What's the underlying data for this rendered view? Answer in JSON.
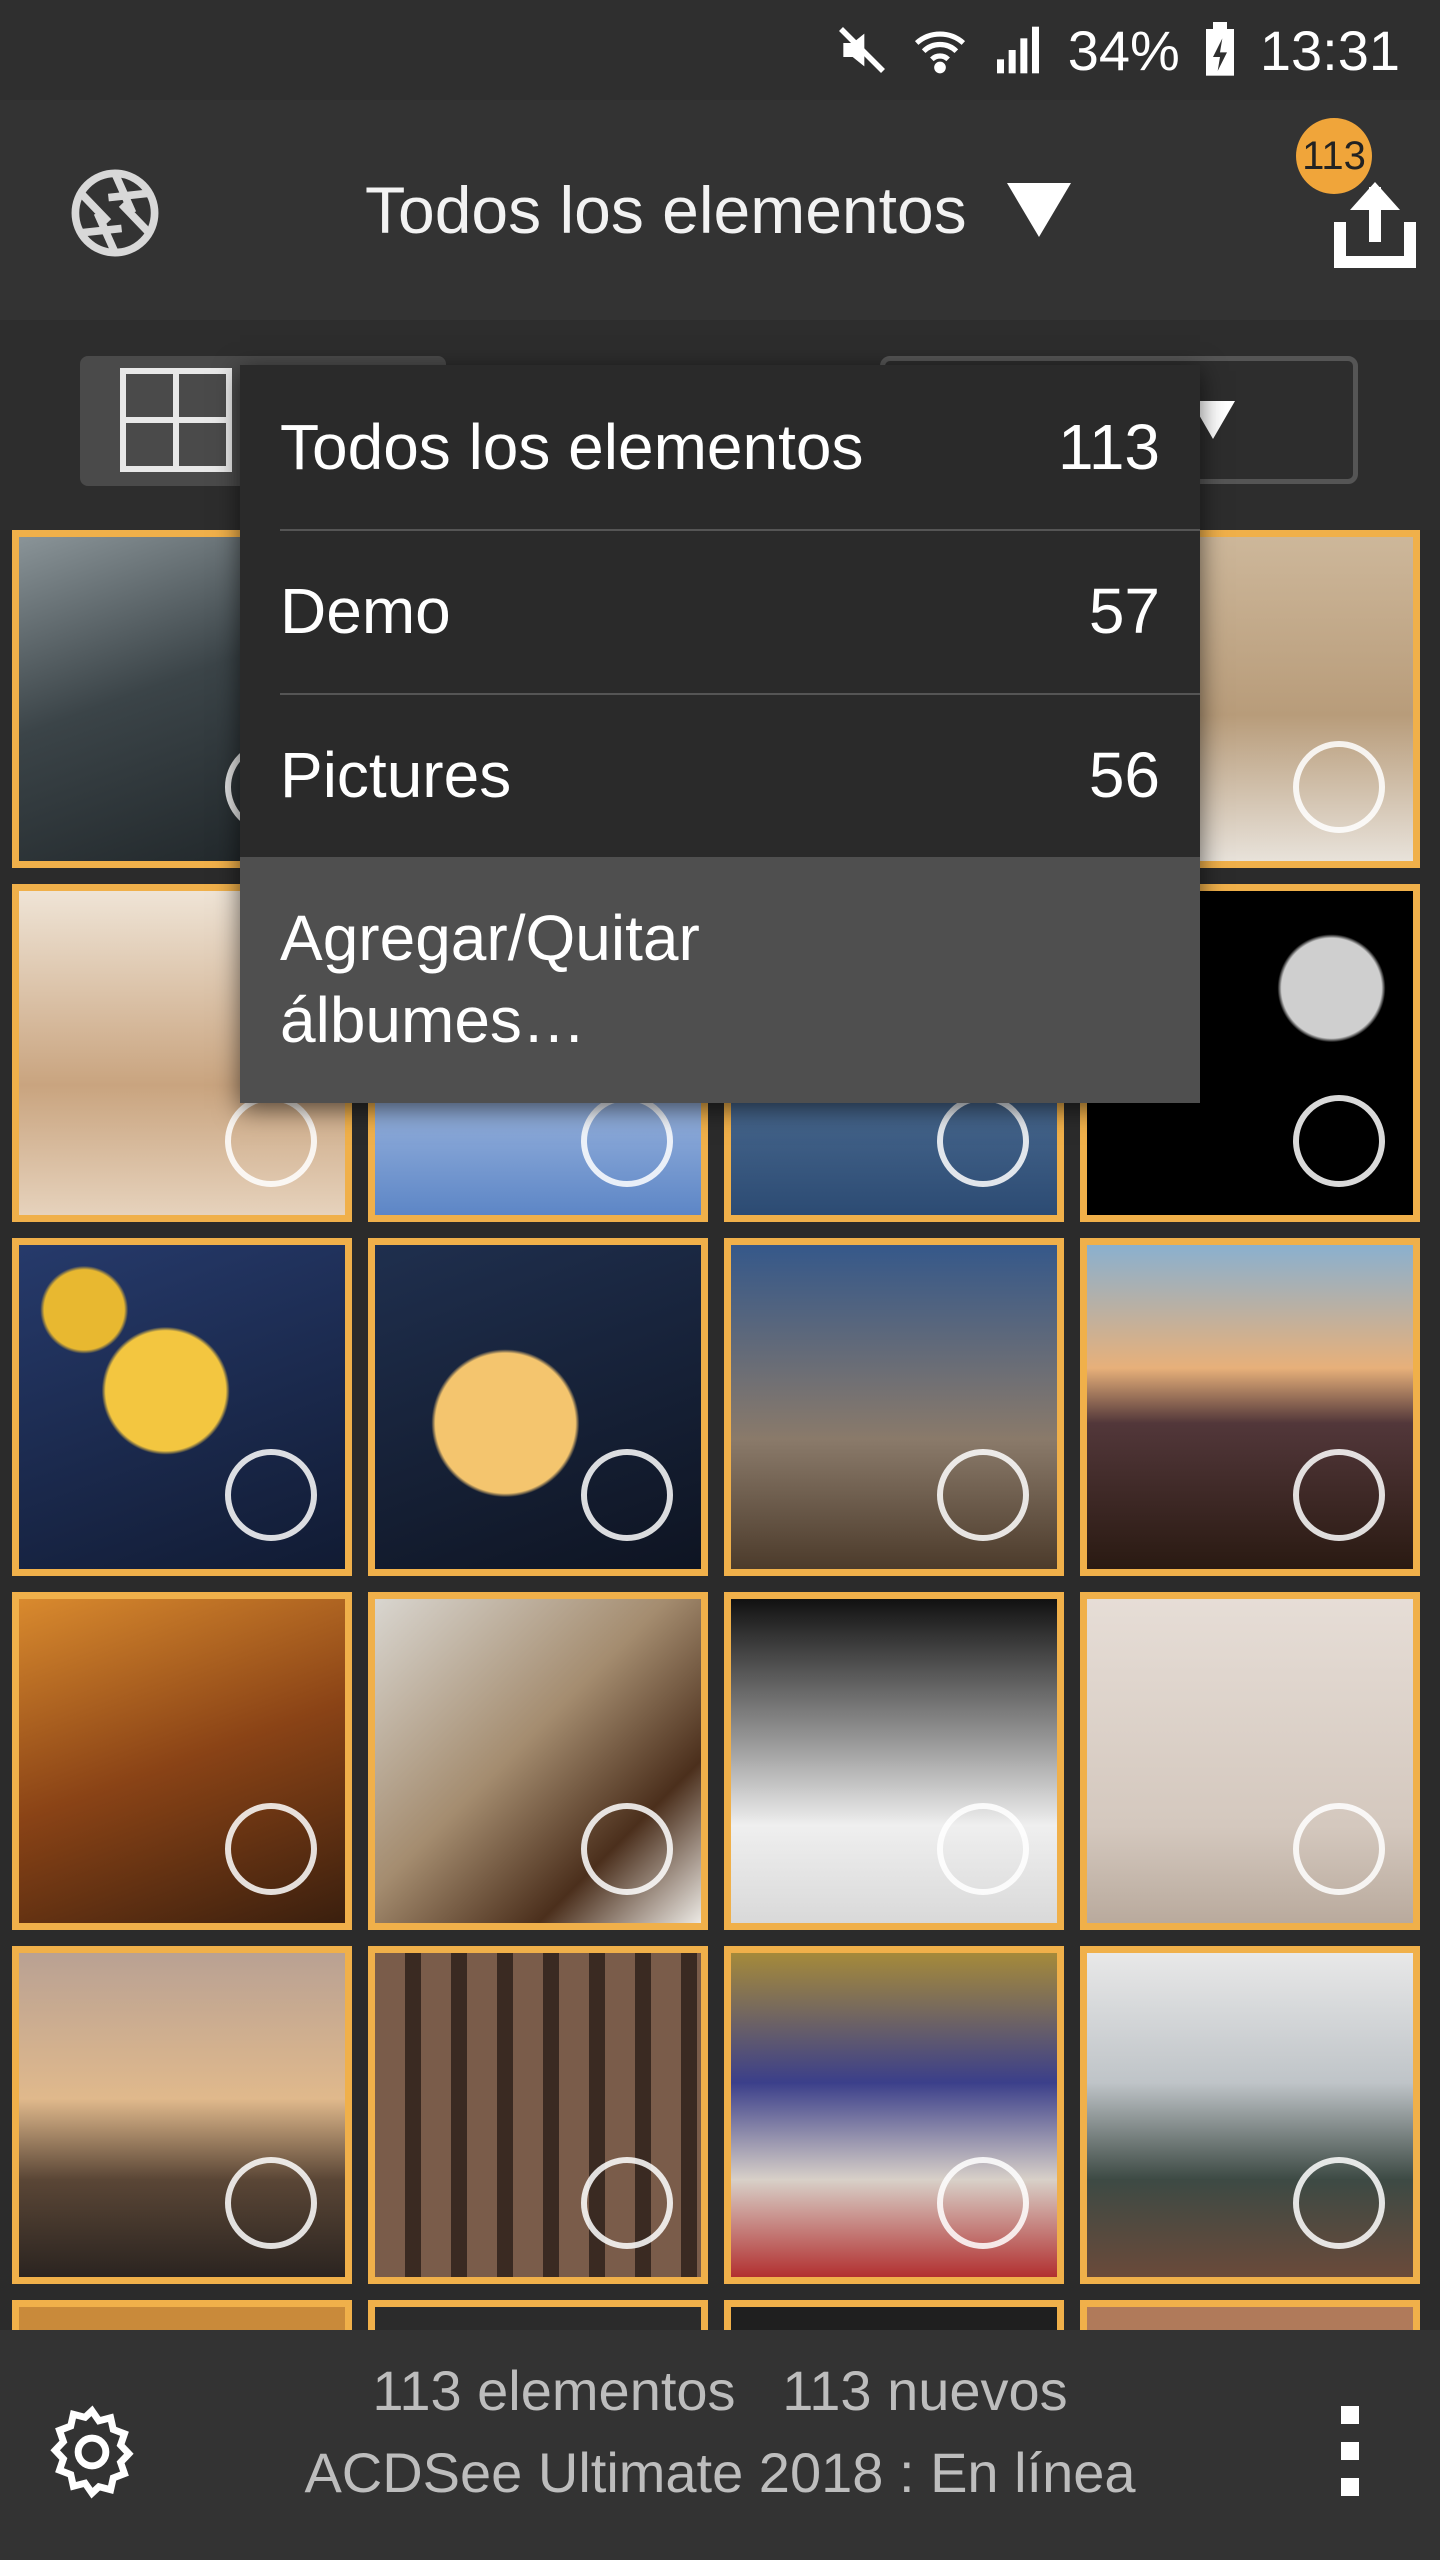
{
  "status_bar": {
    "battery": "34%",
    "time": "13:31"
  },
  "header": {
    "title": "Todos los elementos",
    "upload_badge": "113"
  },
  "album_menu": {
    "items": [
      {
        "label": "Todos los elementos",
        "count": "113"
      },
      {
        "label": "Demo",
        "count": "57"
      },
      {
        "label": "Pictures",
        "count": "56"
      }
    ],
    "action_line1": "Agregar/Quitar",
    "action_line2": "álbumes…"
  },
  "footer": {
    "count_label": "113 elementos",
    "new_label": "113 nuevos",
    "status": "ACDSee Ultimate 2018 : En línea"
  },
  "colors": {
    "accent": "#f0b04a",
    "badge": "#f0a53a"
  }
}
